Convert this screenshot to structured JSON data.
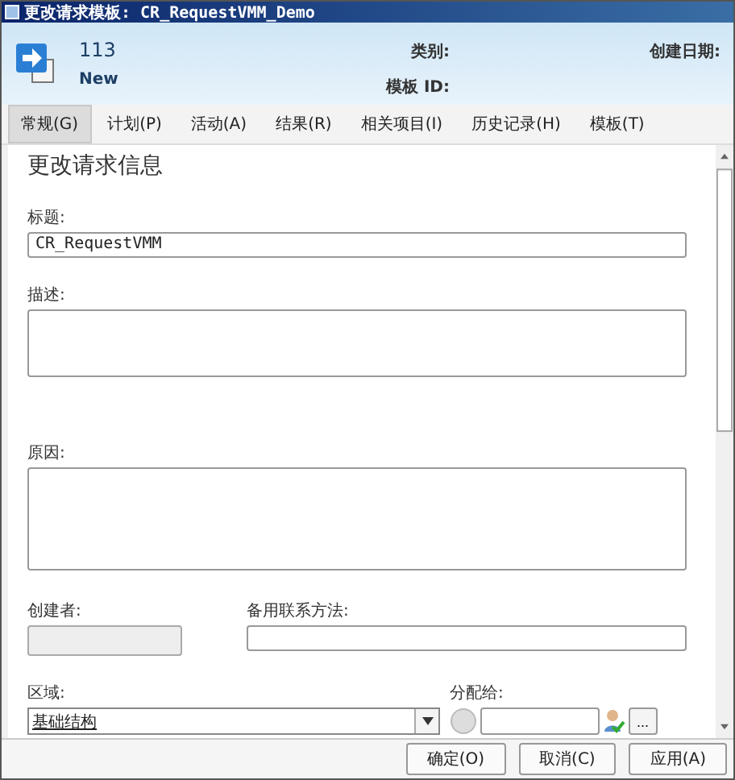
{
  "window": {
    "title": "更改请求模板: CR_RequestVMM_Demo"
  },
  "header": {
    "id": "113",
    "status": "New",
    "category_label": "类别:",
    "template_id_label": "模板 ID:",
    "created_label": "创建日期:"
  },
  "tabs": [
    {
      "label": "常规(G)",
      "selected": true
    },
    {
      "label": "计划(P)",
      "selected": false
    },
    {
      "label": "活动(A)",
      "selected": false
    },
    {
      "label": "结果(R)",
      "selected": false
    },
    {
      "label": "相关项目(I)",
      "selected": false
    },
    {
      "label": "历史记录(H)",
      "selected": false
    },
    {
      "label": "模板(T)",
      "selected": false
    }
  ],
  "section_title": "更改请求信息",
  "form": {
    "title": {
      "label": "标题:",
      "value": "CR_RequestVMM"
    },
    "description": {
      "label": "描述:"
    },
    "reason": {
      "label": "原因:"
    },
    "creator": {
      "label": "创建者:",
      "disabled": true
    },
    "alt_contact": {
      "label": "备用联系方法:"
    },
    "area": {
      "label": "区域:",
      "value": "基础结构"
    },
    "assigned_to": {
      "label": "分配给:",
      "browse": "..."
    }
  },
  "buttons": [
    "确定(O)",
    "取消(C)",
    "应用(A)"
  ]
}
